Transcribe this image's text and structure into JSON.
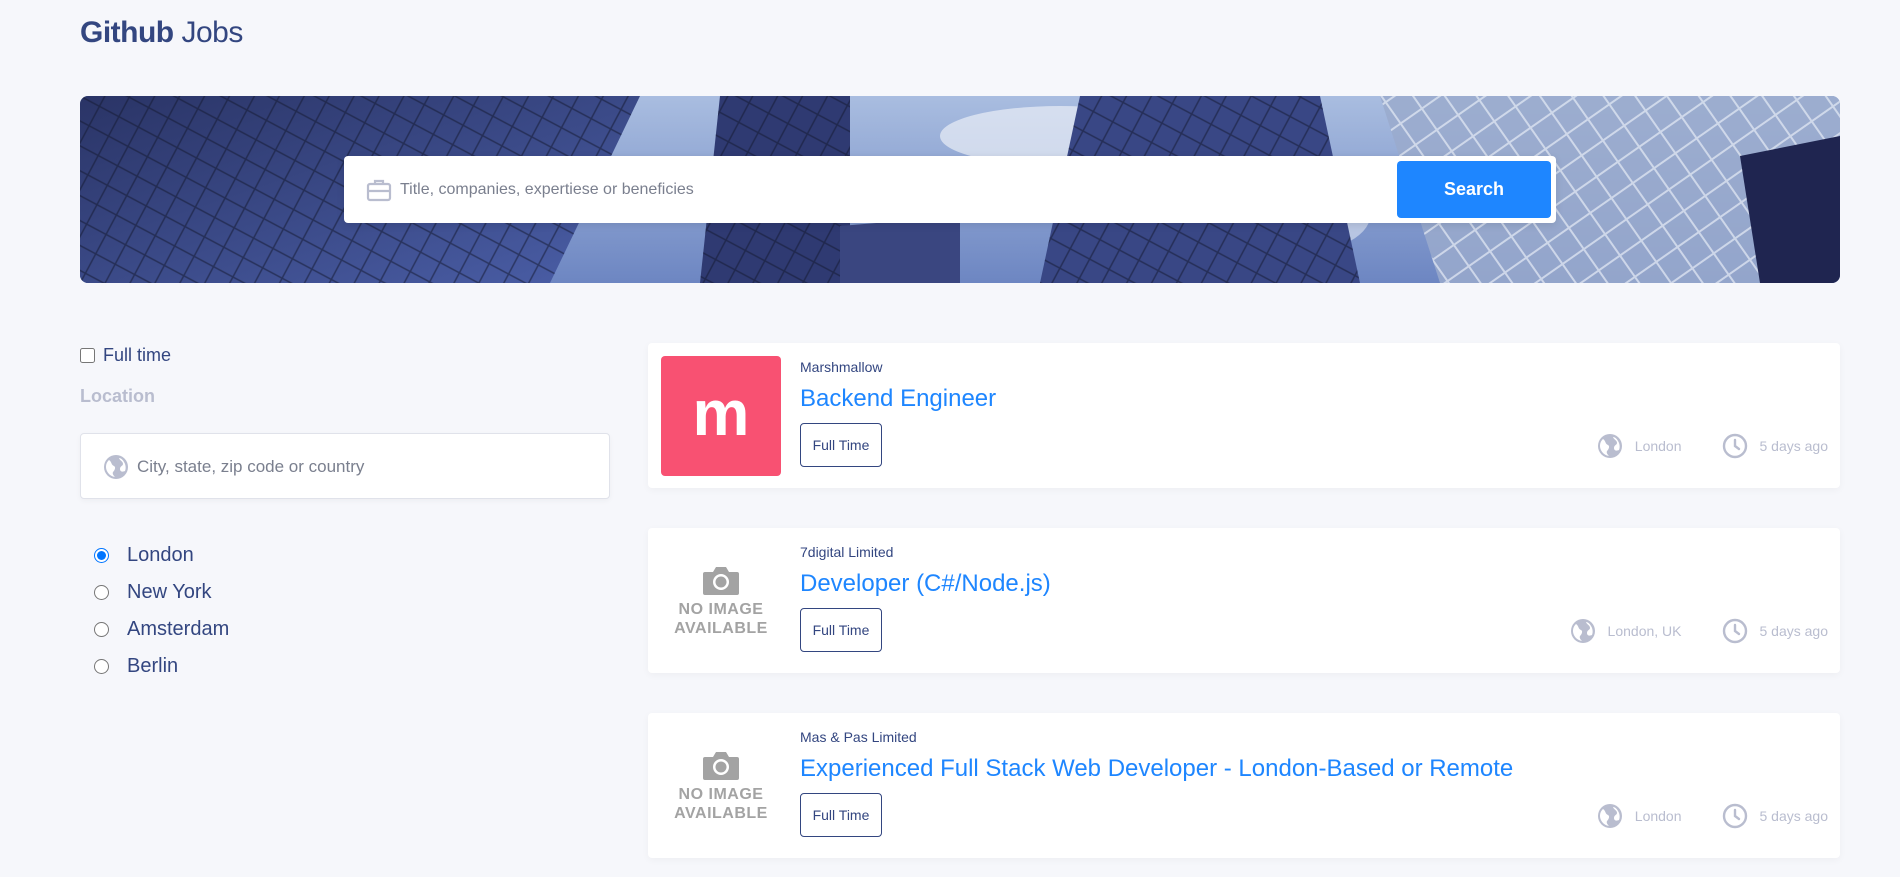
{
  "header": {
    "brand_bold": "Github",
    "brand_light": "Jobs"
  },
  "search": {
    "placeholder": "Title, companies, expertiese or beneficies",
    "button_label": "Search"
  },
  "filters": {
    "full_time_label": "Full time",
    "full_time_checked": false,
    "location_title": "Location",
    "location_placeholder": "City, state, zip code or country",
    "cities": [
      {
        "label": "London",
        "selected": true
      },
      {
        "label": "New York",
        "selected": false
      },
      {
        "label": "Amsterdam",
        "selected": false
      },
      {
        "label": "Berlin",
        "selected": false
      }
    ]
  },
  "jobs": [
    {
      "company": "Marshmallow",
      "title": "Backend Engineer",
      "type": "Full Time",
      "location": "London",
      "posted": "5 days ago",
      "logo": {
        "kind": "brand",
        "letter": "m",
        "color": "#f85172"
      }
    },
    {
      "company": "7digital Limited",
      "title": "Developer (C#/Node.js)",
      "type": "Full Time",
      "location": "London, UK",
      "posted": "5 days ago",
      "logo": {
        "kind": "placeholder",
        "line1": "NO IMAGE",
        "line2": "AVAILABLE"
      }
    },
    {
      "company": "Mas & Pas Limited",
      "title": "Experienced Full Stack Web Developer - London-Based or Remote",
      "type": "Full Time",
      "location": "London",
      "posted": "5 days ago",
      "logo": {
        "kind": "placeholder",
        "line1": "NO IMAGE",
        "line2": "AVAILABLE"
      }
    }
  ],
  "colors": {
    "accent": "#1e86ff",
    "text": "#334680",
    "muted": "#b9bdcf",
    "background": "#f6f7fb"
  },
  "icons": {
    "search_field": "briefcase-icon",
    "location_field": "globe-icon",
    "job_location": "globe-icon",
    "job_posted": "clock-icon",
    "placeholder_logo": "camera-icon"
  }
}
